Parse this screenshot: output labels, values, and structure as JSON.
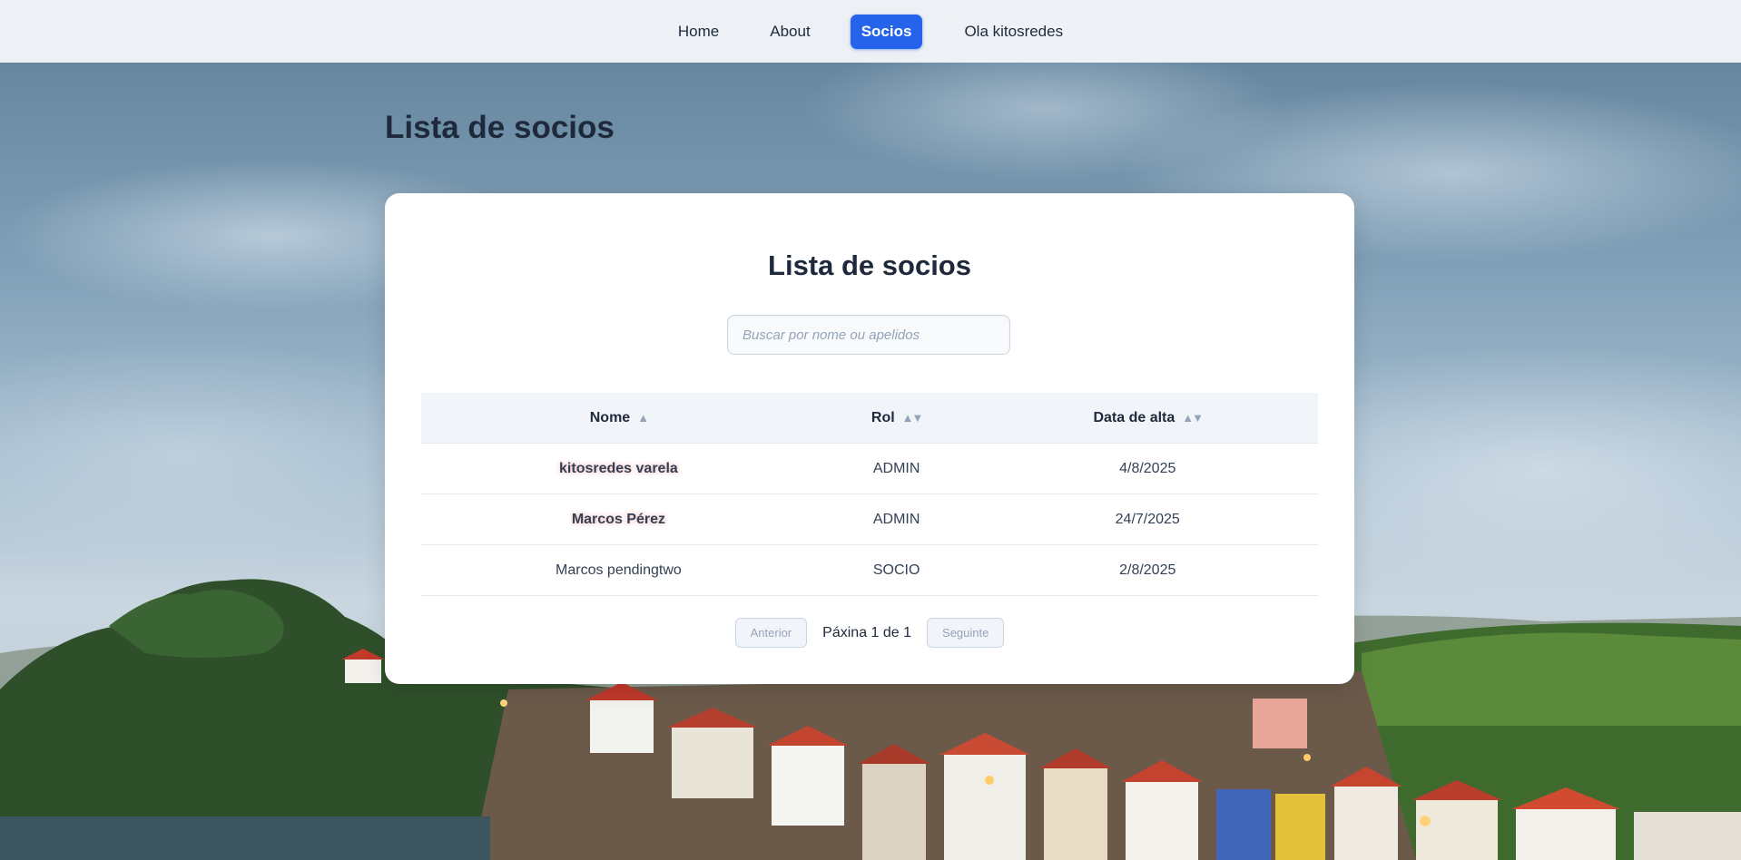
{
  "nav": {
    "items": [
      {
        "label": "Home"
      },
      {
        "label": "About"
      },
      {
        "label": "Socios",
        "active": true
      },
      {
        "label": "Ola kitosredes"
      }
    ]
  },
  "page": {
    "title": "Lista de socios"
  },
  "card": {
    "title": "Lista de socios",
    "search_placeholder": "Buscar por nome ou apelidos",
    "search_value": ""
  },
  "table": {
    "columns": [
      {
        "label": "Nome",
        "sort": "asc"
      },
      {
        "label": "Rol",
        "sort": "none"
      },
      {
        "label": "Data de alta",
        "sort": "none"
      }
    ],
    "rows": [
      {
        "nome": "kitosredes varela",
        "rol": "ADMIN",
        "data": "4/8/2025",
        "highlight": true
      },
      {
        "nome": "Marcos Pérez",
        "rol": "ADMIN",
        "data": "24/7/2025",
        "highlight": true
      },
      {
        "nome": "Marcos pendingtwo",
        "rol": "SOCIO",
        "data": "2/8/2025",
        "highlight": false
      }
    ]
  },
  "pagination": {
    "prev_label": "Anterior",
    "info": "Páxina 1 de 1",
    "next_label": "Seguinte"
  },
  "colors": {
    "accent": "#2563eb",
    "admin_name": "#e5484d",
    "header_bg": "#f1f5f9"
  },
  "icons": {
    "sort_asc": "sort-asc-icon",
    "sort_both": "sort-both-icon"
  }
}
